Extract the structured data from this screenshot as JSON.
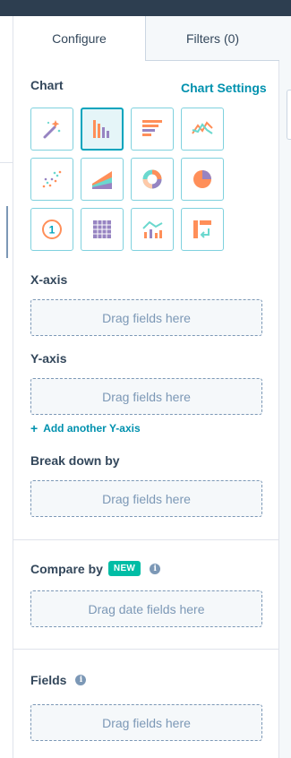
{
  "tabs": {
    "configure": "Configure",
    "filters": "Filters (0)"
  },
  "chart": {
    "title": "Chart",
    "settings_link": "Chart Settings",
    "types": [
      {
        "icon": "magic-wand-icon"
      },
      {
        "icon": "vertical-bar-chart-icon",
        "selected": true
      },
      {
        "icon": "horizontal-bar-chart-icon"
      },
      {
        "icon": "line-chart-icon"
      },
      {
        "icon": "scatter-chart-icon"
      },
      {
        "icon": "area-chart-icon"
      },
      {
        "icon": "donut-chart-icon"
      },
      {
        "icon": "pie-chart-icon"
      },
      {
        "icon": "single-value-icon",
        "text": "1"
      },
      {
        "icon": "table-icon"
      },
      {
        "icon": "combo-chart-icon"
      },
      {
        "icon": "pivot-table-icon"
      }
    ],
    "colors": {
      "accent": "#00a4bd",
      "orange": "#ff8f59",
      "purple": "#9784c2",
      "teal": "#6bd8ce",
      "green": "#00bda5",
      "link": "#0091ae"
    }
  },
  "xaxis": {
    "label": "X-axis",
    "placeholder": "Drag fields here"
  },
  "yaxis": {
    "label": "Y-axis",
    "placeholder": "Drag fields here",
    "add_link": "Add another Y-axis"
  },
  "breakdown": {
    "label": "Break down by",
    "placeholder": "Drag fields here"
  },
  "compare": {
    "label": "Compare by",
    "badge": "NEW",
    "placeholder": "Drag date fields here"
  },
  "fields": {
    "label": "Fields",
    "placeholder": "Drag fields here"
  },
  "icons": {
    "info": "i",
    "plus": "+"
  }
}
